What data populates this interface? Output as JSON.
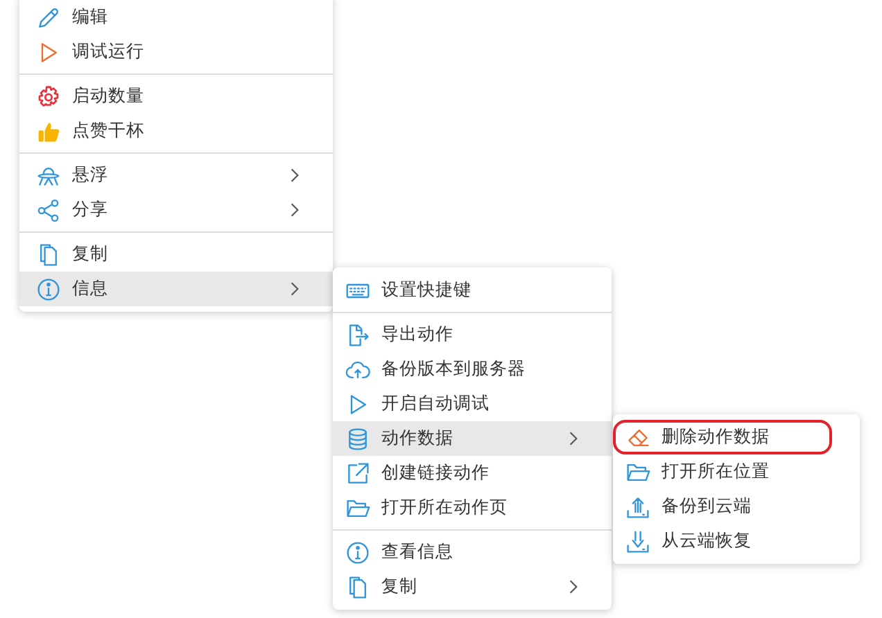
{
  "menus": [
    {
      "groups": [
        [
          {
            "label": "编辑",
            "submenu": false,
            "selected": false,
            "outlined": false
          },
          {
            "label": "调试运行",
            "submenu": false,
            "selected": false,
            "outlined": false
          }
        ],
        [
          {
            "label": "启动数量",
            "submenu": false,
            "selected": false,
            "outlined": false
          },
          {
            "label": "点赞干杯",
            "submenu": false,
            "selected": false,
            "outlined": false
          }
        ],
        [
          {
            "label": "悬浮",
            "submenu": true,
            "selected": false,
            "outlined": false
          },
          {
            "label": "分享",
            "submenu": true,
            "selected": false,
            "outlined": false
          }
        ],
        [
          {
            "label": "复制",
            "submenu": false,
            "selected": false,
            "outlined": false
          },
          {
            "label": "信息",
            "submenu": true,
            "selected": true,
            "outlined": false
          }
        ]
      ]
    },
    {
      "groups": [
        [
          {
            "label": "设置快捷键",
            "submenu": false,
            "selected": false,
            "outlined": false
          }
        ],
        [
          {
            "label": "导出动作",
            "submenu": false,
            "selected": false,
            "outlined": false
          },
          {
            "label": "备份版本到服务器",
            "submenu": false,
            "selected": false,
            "outlined": false
          },
          {
            "label": "开启自动调试",
            "submenu": false,
            "selected": false,
            "outlined": false
          },
          {
            "label": "动作数据",
            "submenu": true,
            "selected": true,
            "outlined": false
          },
          {
            "label": "创建链接动作",
            "submenu": false,
            "selected": false,
            "outlined": false
          },
          {
            "label": "打开所在动作页",
            "submenu": false,
            "selected": false,
            "outlined": false
          }
        ],
        [
          {
            "label": "查看信息",
            "submenu": false,
            "selected": false,
            "outlined": false
          },
          {
            "label": "复制",
            "submenu": true,
            "selected": false,
            "outlined": false
          }
        ]
      ]
    },
    {
      "groups": [
        [
          {
            "label": "删除动作数据",
            "submenu": false,
            "selected": false,
            "outlined": true
          },
          {
            "label": "打开所在位置",
            "submenu": false,
            "selected": false,
            "outlined": false
          },
          {
            "label": "备份到云端",
            "submenu": false,
            "selected": false,
            "outlined": false
          },
          {
            "label": "从云端恢复",
            "submenu": false,
            "selected": false,
            "outlined": false
          }
        ]
      ]
    }
  ]
}
